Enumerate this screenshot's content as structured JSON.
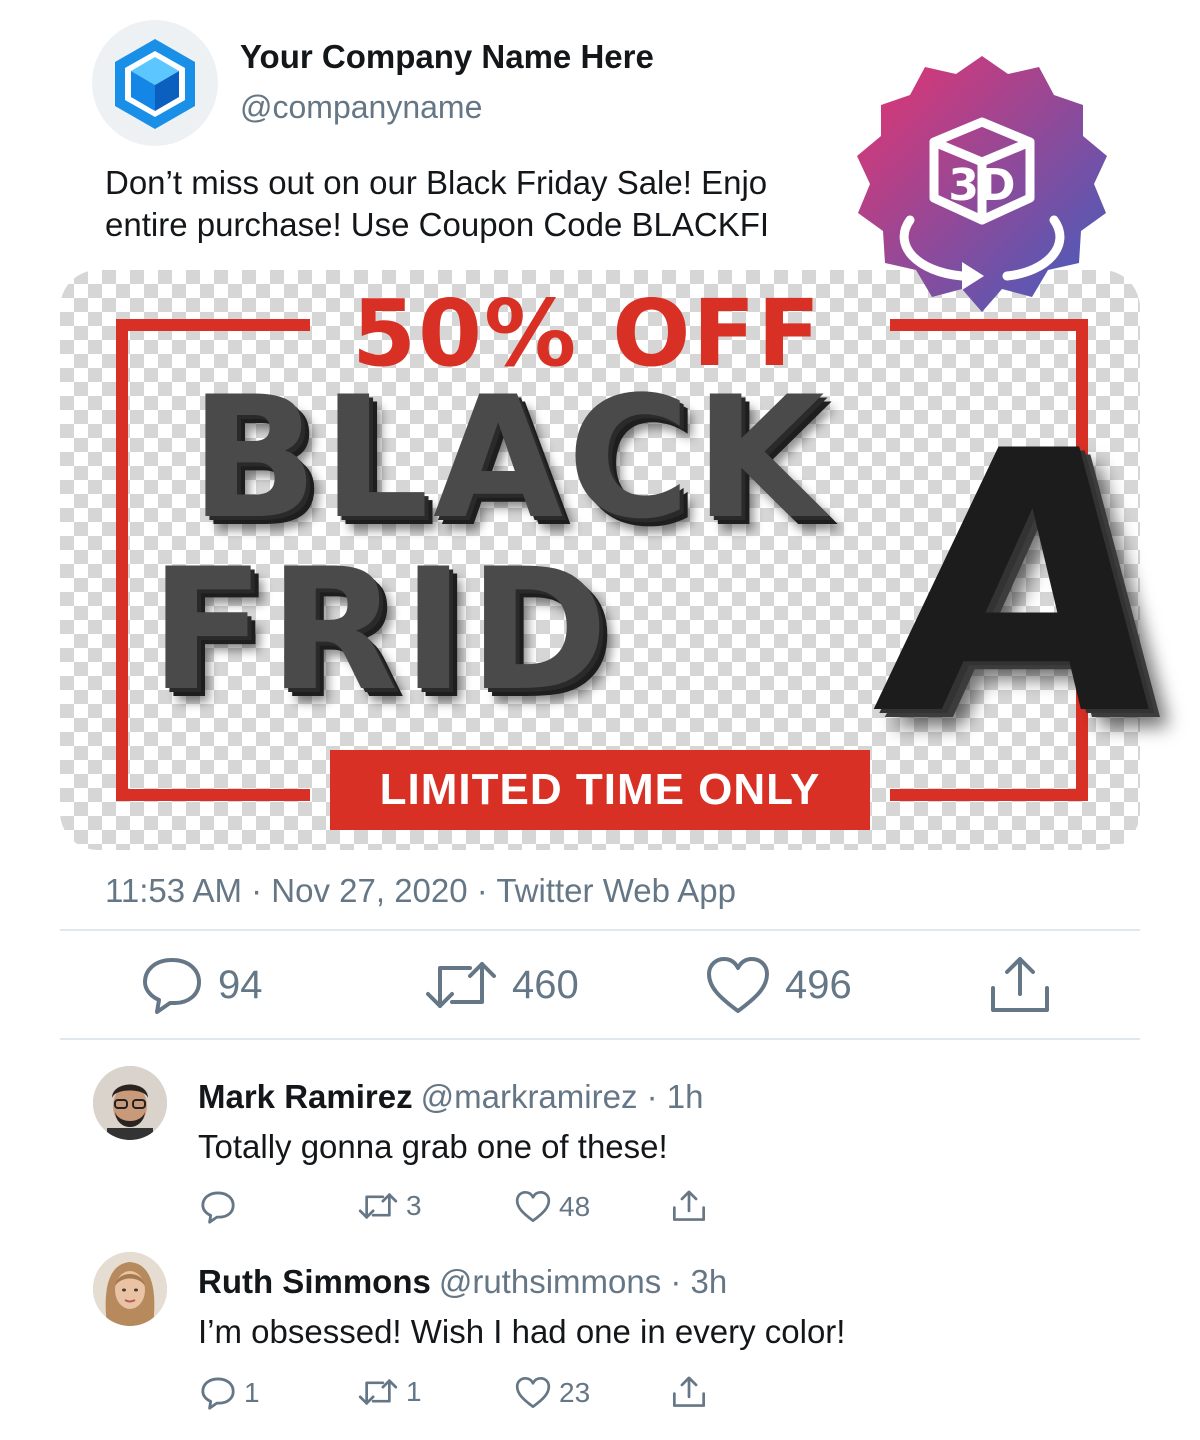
{
  "account": {
    "name": "Your Company Name Here",
    "handle": "@companyname"
  },
  "tweet": {
    "text_line1": "Don’t miss out on our Black Friday Sale! Enjo",
    "text_line2": "entire purchase! Use Coupon Code BLACKFI",
    "meta": "11:53 AM · Nov 27, 2020 · Twitter Web App",
    "replies": "94",
    "retweets": "460",
    "likes": "496"
  },
  "media": {
    "top_text": "50% OFF",
    "line1": "BLACK",
    "line2": "FRID",
    "big_letter": "A",
    "banner": "LIMITED TIME ONLY",
    "badge_text": "3D",
    "accent_color": "#d93025"
  },
  "replies": [
    {
      "name": "Mark Ramirez",
      "handle": "@markramirez · 1h",
      "text": "Totally gonna grab one of these!",
      "reply_count": "",
      "retweets": "3",
      "likes": "48"
    },
    {
      "name": "Ruth Simmons",
      "handle": "@ruthsimmons · 3h",
      "text": "I’m obsessed! Wish I had one in every color!",
      "reply_count": "1",
      "retweets": "1",
      "likes": "23"
    }
  ]
}
